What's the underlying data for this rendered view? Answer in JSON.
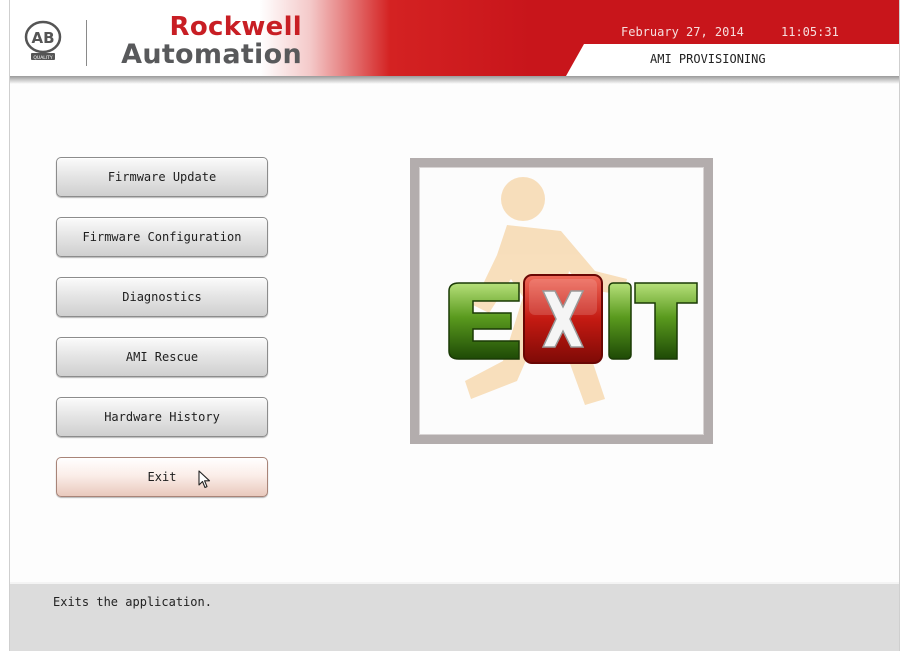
{
  "header": {
    "logo_text": "AB",
    "logo_subtext": "QUALITY",
    "brand_line1": "Rockwell",
    "brand_line2": "Automation",
    "date": "February 27, 2014",
    "time": "11:05:31",
    "app_title": "AMI PROVISIONING"
  },
  "menu": {
    "items": [
      {
        "label": "Firmware Update"
      },
      {
        "label": "Firmware Configuration"
      },
      {
        "label": "Diagnostics"
      },
      {
        "label": "AMI Rescue"
      },
      {
        "label": "Hardware History"
      },
      {
        "label": "Exit"
      }
    ],
    "selected": "Exit"
  },
  "preview": {
    "icon": "exit-running-man-icon",
    "letters": [
      "E",
      "X",
      "I",
      "T"
    ]
  },
  "status": {
    "text": "Exits the application."
  },
  "colors": {
    "brand_red": "#c81e24",
    "brand_gray": "#58595b",
    "button_face": "#e6e6e6",
    "status_bar": "#dcdcdc"
  }
}
